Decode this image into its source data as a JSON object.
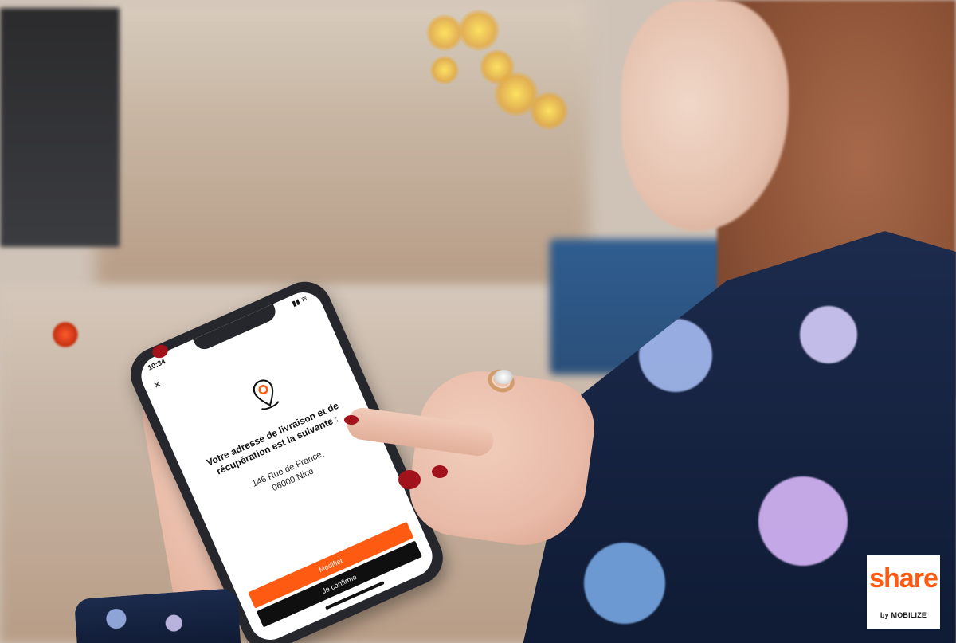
{
  "phone_screen": {
    "status_time": "10:34",
    "status_icons": "▮▮ ≋",
    "close_icon": "close-icon",
    "pin_icon": "location-pin-icon",
    "message": "Votre adresse de livraison et de récupération est la suivante :",
    "address_line1": "146 Rue de France,",
    "address_line2": "06000 Nice",
    "modify_button": "Modifier",
    "confirm_button": "Je confirme"
  },
  "branding": {
    "logo_text": "share",
    "logo_sub": "by MOBILIZE"
  },
  "colors": {
    "accent_orange": "#ff5a12",
    "button_black": "#0f0f0f"
  }
}
